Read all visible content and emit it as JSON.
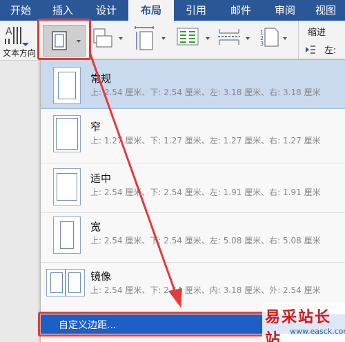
{
  "tabs": [
    {
      "label": "开始"
    },
    {
      "label": "插入"
    },
    {
      "label": "设计"
    },
    {
      "label": "布局"
    },
    {
      "label": "引用"
    },
    {
      "label": "邮件"
    },
    {
      "label": "审阅"
    },
    {
      "label": "视图"
    }
  ],
  "ribbon": {
    "text_direction_label": "文本方向",
    "indent_label": "缩进",
    "left_label": "左:"
  },
  "margins": [
    {
      "name": "常规",
      "desc": "上: 2.54 厘米、下: 2.54 厘米、左: 3.18 厘米、右: 3.18 厘米"
    },
    {
      "name": "窄",
      "desc": "上: 1.27 厘米、下: 1.27 厘米、左: 1.27 厘米、右: 1.27 厘米"
    },
    {
      "name": "适中",
      "desc": "上: 2.54 厘米、下: 2.54 厘米、左: 1.91 厘米、右: 1.91 厘米"
    },
    {
      "name": "宽",
      "desc": "上: 2.54 厘米、下: 2.54 厘米、左: 5.08 厘米、右: 5.08 厘米"
    },
    {
      "name": "镜像",
      "desc": "上: 2.54 厘米、下: 2.54 厘米、内: 3.18 厘米、外: 2.54 厘米"
    }
  ],
  "custom_margins_label": "自定义边距...",
  "watermark": {
    "title": "易采站长站",
    "url": "www.easck.com"
  },
  "colors": {
    "ribbon_blue": "#2b5797",
    "selection": "#c9d9ee",
    "custom_bg": "#1d5fc4",
    "annotation_red": "#e33a3a"
  }
}
